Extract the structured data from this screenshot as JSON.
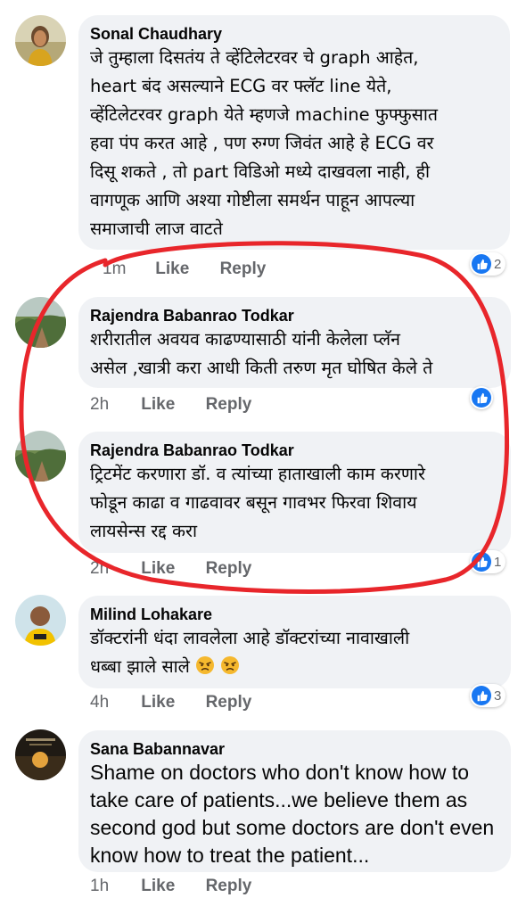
{
  "comments": [
    {
      "author": "Sonal Chaudhary",
      "text": "जे तुम्हाला दिसतंय ते व्हेंटिलेटरवर चे graph आहेत,\nheart बंद असल्याने ECG वर फ्लॅट line येते,\nव्हेंटिलेटरवर graph येते म्हणजे machine फुफ्फुसात\nहवा पंप करत आहे , पण रुग्ण जिवंत आहे हे ECG वर\nदिसू शकते , तो part विडिओ मध्ये दाखवला नाही, ही\nवागणूक आणि अश्या गोष्टीला समर्थन पाहून आपल्या\nसमाजाची लाज वाटते",
      "time": "1m",
      "like": "Like",
      "reply": "Reply",
      "reaction_count": "2"
    },
    {
      "author": "Rajendra Babanrao Todkar",
      "text": "शरीरातील अवयव काढण्यासाठी यांनी केलेला प्लॅन\nअसेल ,खात्री करा आधी किती तरुण मृत घोषित केले ते",
      "time": "2h",
      "like": "Like",
      "reply": "Reply",
      "reaction_count": ""
    },
    {
      "author": "Rajendra Babanrao Todkar",
      "text": "ट्रिटमेंट करणारा डॉ. व त्यांच्या हाताखाली काम करणारे\nफोडून काढा व गाढवावर बसून गावभर फिरवा शिवाय\nलायसेन्स रद्द करा",
      "time": "2h",
      "like": "Like",
      "reply": "Reply",
      "reaction_count": "1"
    },
    {
      "author": "Milind Lohakare",
      "text": "डॉक्टरांनी धंदा लावलेला आहे डॉक्टरांच्या नावाखाली\nधब्बा झाले साले",
      "time": "4h",
      "like": "Like",
      "reply": "Reply",
      "reaction_count": "3"
    },
    {
      "author": "Sana Babannavar",
      "text": "Shame on doctors who don't know how to\ntake care of patients...we believe them as\nsecond god but some doctors are don't even\nknow how to treat the patient...",
      "time": "1h",
      "like": "Like",
      "reply": "Reply",
      "reaction_count": ""
    }
  ],
  "colors": {
    "bubble": "#f0f2f5",
    "meta_text": "#65676b",
    "reaction_blue": "#1877f2",
    "annotation_red": "#e8262b"
  },
  "icons": {
    "reaction": "like-thumb-icon",
    "emoji": "angry-face-emoji"
  }
}
